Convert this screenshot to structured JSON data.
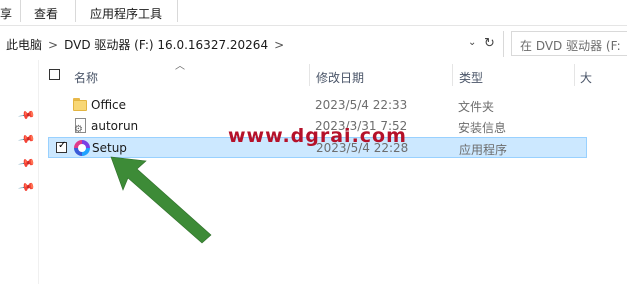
{
  "ribbon": {
    "tabs": [
      {
        "label": "享"
      },
      {
        "label": "查看"
      },
      {
        "label": "应用程序工具"
      }
    ]
  },
  "address_bar": {
    "crumbs": [
      "此电脑",
      "DVD 驱动器 (F:) 16.0.16327.20264"
    ],
    "separator": ">",
    "dropdown_glyph": "⌄",
    "refresh_glyph": "↻"
  },
  "search": {
    "placeholder": "在 DVD 驱动器 (F:"
  },
  "nav_pane": {
    "pinned_icon": "pin-icon"
  },
  "columns": {
    "name": "名称",
    "date_modified": "修改日期",
    "type": "类型",
    "size": "大"
  },
  "files": [
    {
      "name": "Office",
      "date": "2023/5/4 22:33",
      "type": "文件夹",
      "icon": "folder-icon",
      "selected": false
    },
    {
      "name": "autorun",
      "date": "2023/3/31 7:52",
      "type": "安装信息",
      "icon": "setup-information-icon",
      "selected": false
    },
    {
      "name": "Setup",
      "date": "2023/5/4 22:28",
      "type": "应用程序",
      "icon": "office-setup-icon",
      "selected": true
    }
  ],
  "watermark": "www.dgrai.com",
  "colors": {
    "selection_bg": "#cce8ff",
    "selection_border": "#99d1ff",
    "watermark": "#b5112a",
    "arrow": "#3d8b37"
  }
}
